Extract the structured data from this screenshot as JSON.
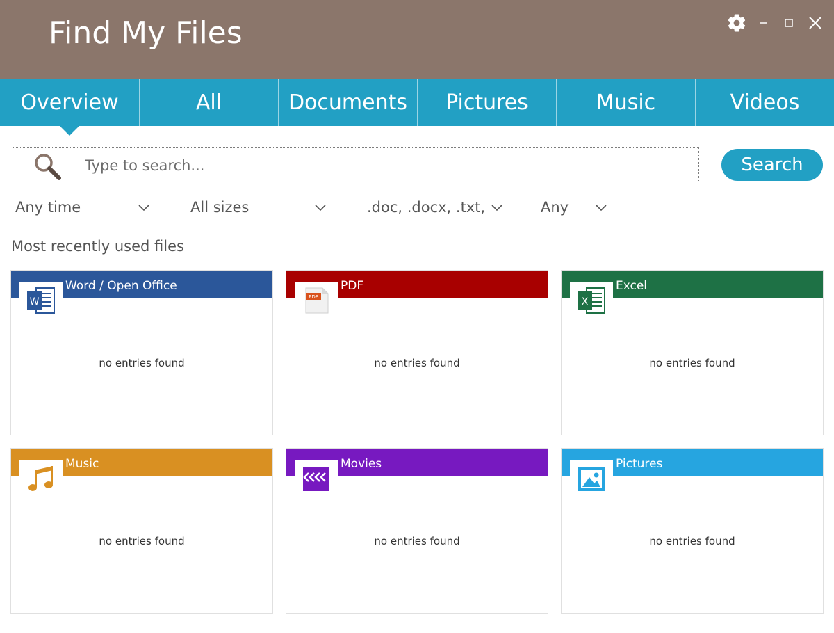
{
  "window": {
    "title": "Find My Files",
    "controls": [
      "gear-icon",
      "minimize-icon",
      "maximize-icon",
      "close-icon"
    ]
  },
  "tabs": [
    {
      "label": "Overview",
      "active": true
    },
    {
      "label": "All"
    },
    {
      "label": "Documents"
    },
    {
      "label": "Pictures"
    },
    {
      "label": "Music"
    },
    {
      "label": "Videos"
    }
  ],
  "search": {
    "placeholder": "Type to search...",
    "value": "",
    "button_label": "Search"
  },
  "filters": [
    {
      "label": "Any time"
    },
    {
      "label": "All sizes"
    },
    {
      "label": ".doc, .docx, .txt, .xl"
    },
    {
      "label": "Any"
    }
  ],
  "recent": {
    "section_title": "Most recently used files",
    "cards": [
      {
        "title": "Word / Open Office",
        "color": "#2b579a",
        "icon": "word-icon",
        "empty_text": "no entries found"
      },
      {
        "title": "PDF",
        "color": "#a80000",
        "icon": "pdf-icon",
        "empty_text": "no entries found"
      },
      {
        "title": "Excel",
        "color": "#1e7145",
        "icon": "excel-icon",
        "empty_text": "no entries found"
      },
      {
        "title": "Music",
        "color": "#d99022",
        "icon": "music-note-icon",
        "empty_text": "no entries found"
      },
      {
        "title": "Movies",
        "color": "#7719c0",
        "icon": "clapperboard-icon",
        "empty_text": "no entries found"
      },
      {
        "title": "Pictures",
        "color": "#26a5e0",
        "icon": "picture-icon",
        "empty_text": "no entries found"
      }
    ]
  },
  "colors": {
    "titlebar": "#8b766b",
    "accent": "#22a0c4"
  }
}
